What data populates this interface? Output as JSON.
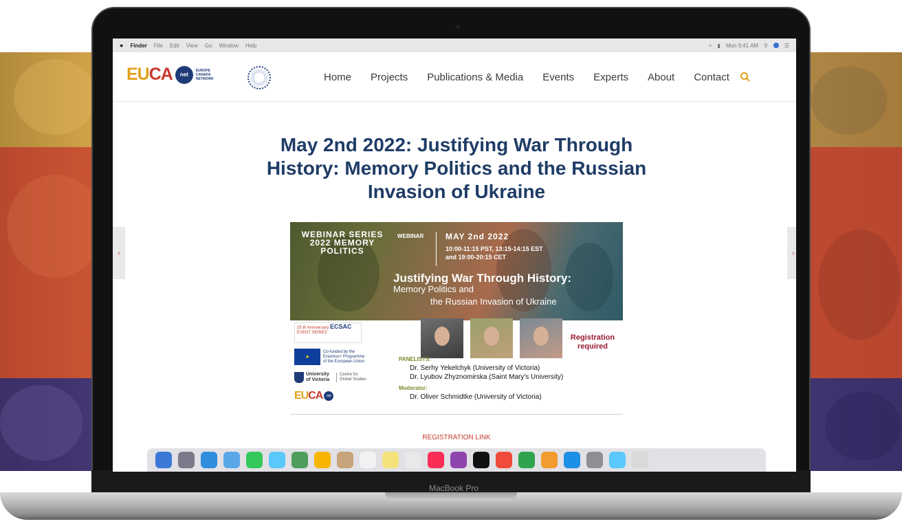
{
  "device": {
    "label": "MacBook Pro"
  },
  "menubar": {
    "app": "Finder",
    "items": [
      "File",
      "Edit",
      "View",
      "Go",
      "Window",
      "Help"
    ],
    "clock": "Mon 9:41 AM"
  },
  "site": {
    "logo": {
      "main_a": "EU",
      "main_b": "CA",
      "badge": "net",
      "tagline": "EUROPE CANADA NETWORK"
    },
    "nav": [
      "Home",
      "Projects",
      "Publications & Media",
      "Events",
      "Experts",
      "About",
      "Contact"
    ]
  },
  "post": {
    "title": "May 2nd 2022: Justifying War Through History: Memory Politics and the Russian Invasion of Ukraine",
    "registration_link": "REGISTRATION LINK"
  },
  "flyer": {
    "series": "WEBINAR SERIES 2022 MEMORY POLITICS",
    "tag": "WEBINAR",
    "date": "MAY 2nd 2022",
    "time_line1": "10:00-11:15 PST, 13:15-14:15 EST",
    "time_line2": "and 19:00-20:15 CET",
    "headline": "Justifying War Through History:",
    "subline1": "Memory Politics and",
    "subline2": "the Russian Invasion of Ukraine",
    "registration_required": "Registration required",
    "panelists_label": "PANELISTS:",
    "panelists": [
      "Dr. Serhy Yekelchyk (University of Victoria)",
      "Dr. Lyubov Zhyznomirska (Saint Mary's University)"
    ],
    "moderator_label": "Moderator:",
    "moderator": "Dr. Oliver Schmidtke (University of Victoria)",
    "sponsors": {
      "ecsac_line": "25 th Anniversary",
      "ecsac_name": "ECSAC",
      "ecsac_event": "EVENT SERIES",
      "eu_text": "Co-funded by the Erasmus+ Programme of the European Union",
      "uvic_name": "University of Victoria",
      "uvic_centre": "Centre for Global Studies"
    }
  },
  "colors": {
    "title": "#1f3c66",
    "accent_red": "#c0392b",
    "brand_gold": "#e0a01a",
    "brand_navy": "#1f3c78"
  }
}
